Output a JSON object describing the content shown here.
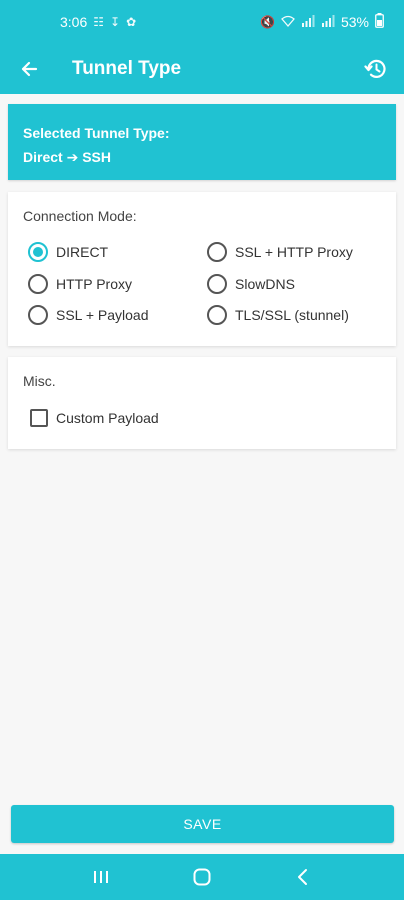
{
  "status_bar": {
    "time": "3:06",
    "battery": "53%"
  },
  "toolbar": {
    "title": "Tunnel Type"
  },
  "selected": {
    "label": "Selected Tunnel Type:",
    "value": "Direct ➔ SSH"
  },
  "connection_mode": {
    "title": "Connection Mode:",
    "options": [
      {
        "label": "DIRECT",
        "checked": true
      },
      {
        "label": "SSL + HTTP Proxy",
        "checked": false
      },
      {
        "label": "HTTP Proxy",
        "checked": false
      },
      {
        "label": "SlowDNS",
        "checked": false
      },
      {
        "label": "SSL + Payload",
        "checked": false
      },
      {
        "label": "TLS/SSL (stunnel)",
        "checked": false
      }
    ]
  },
  "misc": {
    "title": "Misc.",
    "custom_payload_label": "Custom Payload",
    "custom_payload_checked": false
  },
  "save_label": "SAVE",
  "colors": {
    "accent": "#20c2d2",
    "background": "#f7f7f7"
  }
}
